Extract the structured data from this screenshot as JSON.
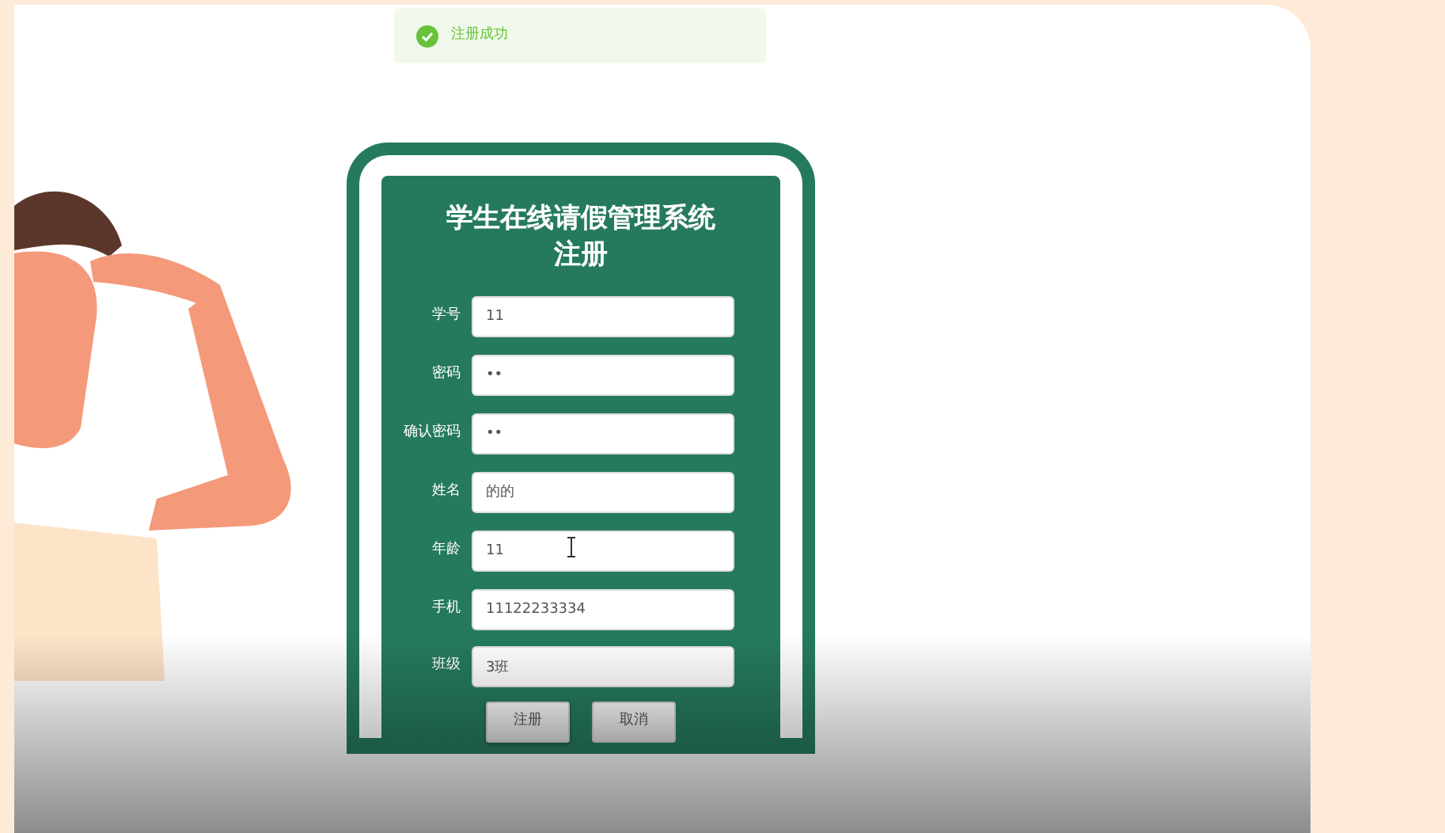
{
  "toast": {
    "kind": "success",
    "text": "注册成功"
  },
  "form": {
    "title_lines": [
      "学生在线请假管理系统",
      "注册"
    ],
    "fields": [
      {
        "label": "学号",
        "value": "11"
      },
      {
        "label": "密码",
        "value": "••"
      },
      {
        "label": "确认密码",
        "value": "••"
      },
      {
        "label": "姓名",
        "value": "的的"
      },
      {
        "label": "年龄",
        "value": "11",
        "pointer": true
      },
      {
        "label": "手机",
        "value": "11122233334"
      },
      {
        "label": "班级",
        "value": "3班"
      }
    ],
    "buttons": [
      {
        "label": "注册",
        "kind": "submit"
      },
      {
        "label": "取消",
        "kind": "cancel"
      }
    ]
  }
}
